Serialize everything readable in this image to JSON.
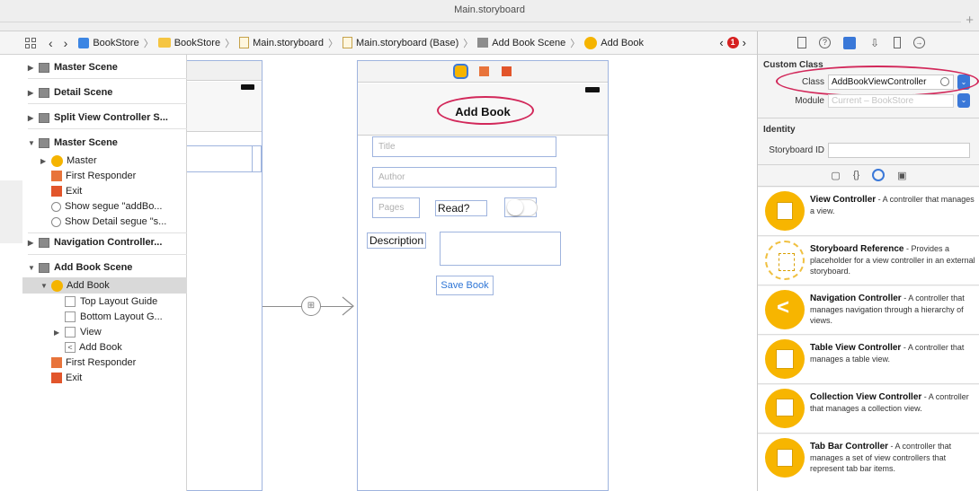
{
  "window": {
    "title": "Main.storyboard",
    "new_tab": "+"
  },
  "jumpbar": {
    "items": [
      "BookStore",
      "BookStore",
      "Main.storyboard",
      "Main.storyboard (Base)",
      "Add Book Scene",
      "Add Book"
    ],
    "error_count": "1"
  },
  "outline": {
    "rows": [
      "Master Scene",
      "Detail Scene",
      "Split View Controller S...",
      "Master Scene",
      "Master",
      "First Responder",
      "Exit",
      "Show segue \"addBo...",
      "Show Detail segue \"s...",
      "Navigation Controller...",
      "Add Book Scene",
      "Add Book",
      "Top Layout Guide",
      "Bottom Layout G...",
      "View",
      "Add Book",
      "First Responder",
      "Exit"
    ]
  },
  "scene": {
    "nav_title": "Add Book",
    "title_placeholder": "Title",
    "author_placeholder": "Author",
    "pages_placeholder": "Pages",
    "read_label": "Read?",
    "description_label": "Description",
    "save_button": "Save Book"
  },
  "inspector": {
    "custom_class_title": "Custom Class",
    "class_label": "Class",
    "class_value": "AddBookViewController",
    "module_label": "Module",
    "module_value": "Current – BookStore",
    "identity_title": "Identity",
    "storyboard_id_label": "Storyboard ID"
  },
  "library": [
    {
      "name": "View Controller",
      "desc": " - A controller that manages a view."
    },
    {
      "name": "Storyboard Reference",
      "desc": " - Provides a placeholder for a view controller in an external storyboard."
    },
    {
      "name": "Navigation Controller",
      "desc": " - A controller that manages navigation through a hierarchy of views."
    },
    {
      "name": "Table View Controller",
      "desc": " - A controller that manages a table view."
    },
    {
      "name": "Collection View Controller",
      "desc": " - A controller that manages a collection view."
    },
    {
      "name": "Tab Bar Controller",
      "desc": " - A controller that manages a set of view controllers that represent tab bar items."
    }
  ],
  "colors": {
    "accent": "#3a78d8",
    "highlight": "#d2285a",
    "vc_yellow": "#f5b400"
  }
}
